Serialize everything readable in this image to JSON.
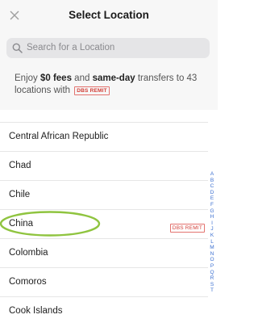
{
  "header": {
    "title": "Select Location",
    "close_icon": "close-icon"
  },
  "search": {
    "placeholder": "Search for a Location"
  },
  "promo": {
    "text_1": "Enjoy ",
    "fees": "$0 fees",
    "text_2": " and ",
    "sameday": "same-day",
    "text_3": " transfers to 43 locations with ",
    "badge": "DBS REMIT"
  },
  "list": {
    "items": [
      {
        "label": "Central African Republic",
        "badge": ""
      },
      {
        "label": "Chad",
        "badge": ""
      },
      {
        "label": "Chile",
        "badge": ""
      },
      {
        "label": "China",
        "badge": "DBS REMIT"
      },
      {
        "label": "Colombia",
        "badge": ""
      },
      {
        "label": "Comoros",
        "badge": ""
      },
      {
        "label": "Cook Islands",
        "badge": ""
      }
    ]
  },
  "alphabet": [
    "A",
    "B",
    "C",
    "D",
    "E",
    "F",
    "G",
    "H",
    "I",
    "J",
    "K",
    "L",
    "M",
    "N",
    "O",
    "P",
    "Q",
    "R",
    "S",
    "T"
  ],
  "colors": {
    "highlight": "#8fc43f",
    "badge": "#d23c35",
    "index": "#3b6fd0"
  }
}
